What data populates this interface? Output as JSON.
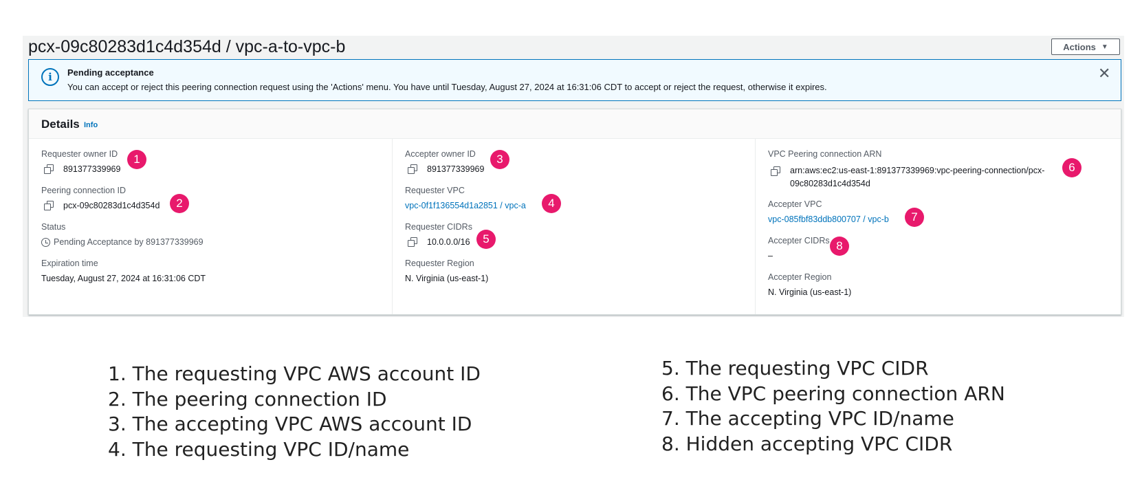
{
  "page": {
    "title": "pcx-09c80283d1c4d354d / vpc-a-to-vpc-b",
    "actions_label": "Actions",
    "actions_caret": "▼"
  },
  "flash": {
    "icon": "info-icon",
    "icon_glyph": "i",
    "title": "Pending acceptance",
    "message": "You can accept or reject this peering connection request using the 'Actions' menu. You have until Tuesday, August 27, 2024 at 16:31:06 CDT to accept or reject the request, otherwise it expires.",
    "close_glyph": "✕"
  },
  "details": {
    "title": "Details",
    "info_link": "Info",
    "requester_owner_id": {
      "label": "Requester owner ID",
      "value": "891377339969"
    },
    "peering_connection_id": {
      "label": "Peering connection ID",
      "value": "pcx-09c80283d1c4d354d"
    },
    "status": {
      "label": "Status",
      "value": "Pending Acceptance by 891377339969"
    },
    "expiration_time": {
      "label": "Expiration time",
      "value": "Tuesday, August 27, 2024 at 16:31:06 CDT"
    },
    "accepter_owner_id": {
      "label": "Accepter owner ID",
      "value": "891377339969"
    },
    "requester_vpc": {
      "label": "Requester VPC",
      "value": "vpc-0f1f136554d1a2851 / vpc-a"
    },
    "requester_cidrs": {
      "label": "Requester CIDRs",
      "value": "10.0.0.0/16"
    },
    "requester_region": {
      "label": "Requester Region",
      "value": "N. Virginia (us-east-1)"
    },
    "peering_arn": {
      "label": "VPC Peering connection ARN",
      "value": "arn:aws:ec2:us-east-1:891377339969:vpc-peering-connection/pcx-09c80283d1c4d354d"
    },
    "accepter_vpc": {
      "label": "Accepter VPC",
      "value": "vpc-085fbf83ddb800707 / vpc-b"
    },
    "accepter_cidrs": {
      "label": "Accepter CIDRs",
      "value": "–"
    },
    "accepter_region": {
      "label": "Accepter Region",
      "value": "N. Virginia (us-east-1)"
    }
  },
  "badges": [
    "1",
    "2",
    "3",
    "4",
    "5",
    "6",
    "7",
    "8"
  ],
  "legend": {
    "left": [
      {
        "num": "1.",
        "text": "The requesting VPC AWS account ID"
      },
      {
        "num": "2.",
        "text": "The peering connection ID"
      },
      {
        "num": "3.",
        "text": "The accepting VPC AWS account ID"
      },
      {
        "num": "4.",
        "text": "The requesting VPC ID/name"
      }
    ],
    "right": [
      {
        "num": "5.",
        "text": "The requesting VPC CIDR"
      },
      {
        "num": "6.",
        "text": "The VPC peering connection ARN"
      },
      {
        "num": "7.",
        "text": "The accepting VPC ID/name"
      },
      {
        "num": "8.",
        "text": "Hidden accepting VPC CIDR"
      }
    ]
  },
  "colors": {
    "link": "#0073bb",
    "badge": "#e8196c",
    "flash_bg": "#f1faff",
    "flash_border": "#0073bb"
  }
}
